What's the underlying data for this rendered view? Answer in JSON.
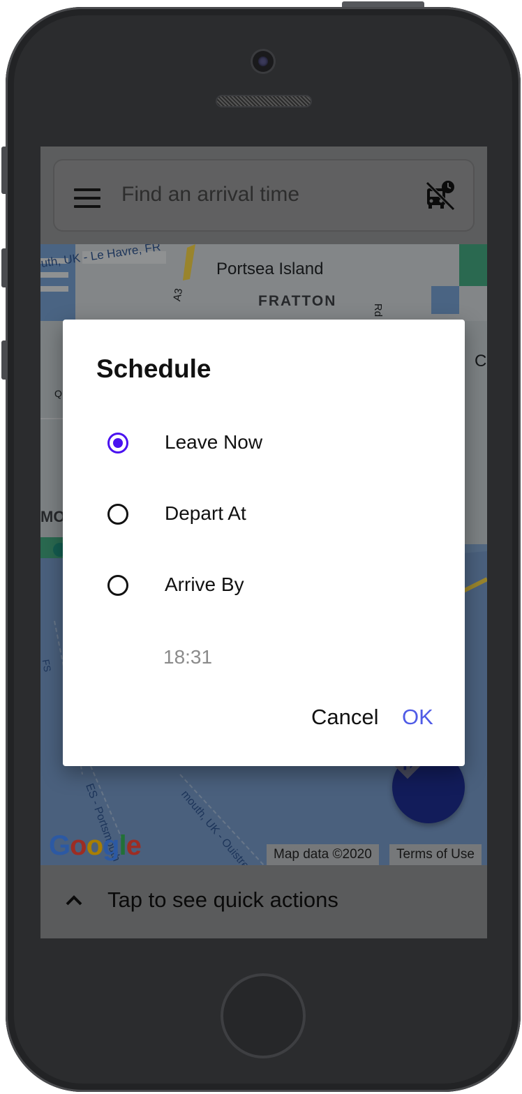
{
  "search": {
    "placeholder": "Find an arrival time",
    "icon": "bus-off-icon"
  },
  "map": {
    "labels": {
      "route_ferry_top": "uth, UK - Le Havre, FR",
      "island": "Portsea Island",
      "district": "FRATTON",
      "road_a3": "A3",
      "road_rd": "Rd",
      "partial_c": "C",
      "partial_q": "Q",
      "partial_mo": "MO",
      "route_ferry_bottom_left": "ES - Portsmouth",
      "route_ferry_bottom": "mouth, UK - Ouistreham, F",
      "partial_fs": "FS"
    },
    "google_logo": "Google",
    "attribution": "Map data ©2020",
    "terms": "Terms of Use",
    "colors": {
      "water": "#3a6fb7",
      "park": "#1f9e6a",
      "road_yellow": "#e5c542"
    }
  },
  "dialog": {
    "title": "Schedule",
    "options": [
      {
        "label": "Leave Now",
        "selected": true
      },
      {
        "label": "Depart At",
        "selected": false
      },
      {
        "label": "Arrive By",
        "selected": false
      }
    ],
    "time": "18:31",
    "cancel_label": "Cancel",
    "ok_label": "OK"
  },
  "bottom_bar": {
    "text": "Tap to see quick actions",
    "icon": "chevron-up-icon"
  },
  "fab": {
    "icon": "directions-icon"
  },
  "colors": {
    "accent": "#4a12f0",
    "ok_button": "#4f5be6",
    "fab": "#1b2a86"
  }
}
